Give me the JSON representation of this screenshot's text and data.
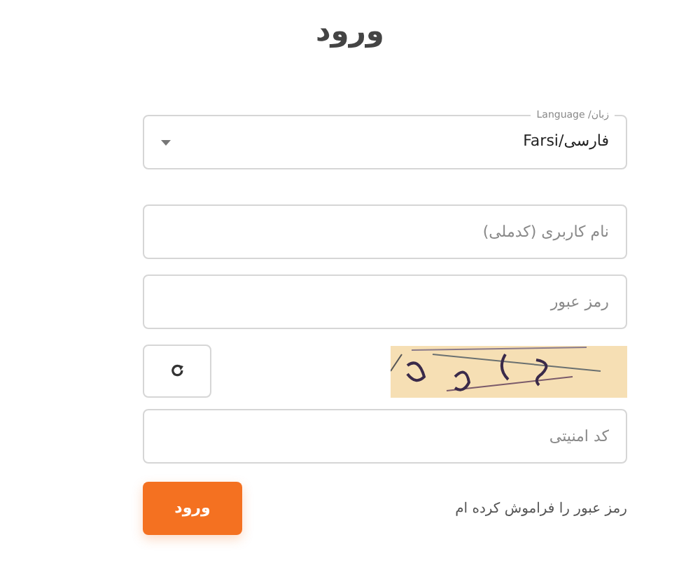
{
  "title": "ورود",
  "language_select": {
    "label": "زبان/ Language",
    "value": "فارسی/Farsi"
  },
  "fields": [
    {
      "placeholder": "نام کاربری (کدملی)"
    },
    {
      "placeholder": "رمز عبور"
    }
  ],
  "security_field": {
    "placeholder": "کد امنیتی"
  },
  "login_button": "ورود",
  "forgot_link": "رمز عبور را فراموش کرده ام"
}
